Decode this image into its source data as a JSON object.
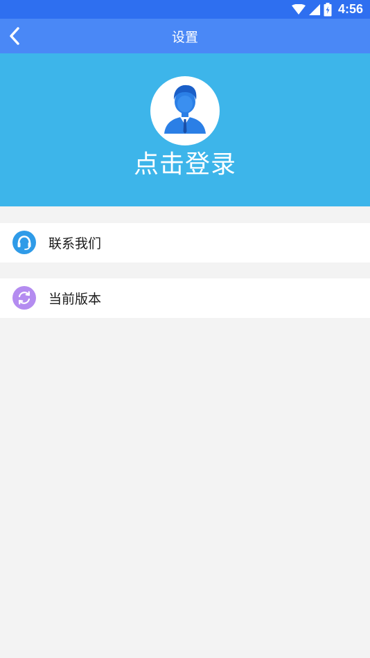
{
  "status_bar": {
    "time": "4:56",
    "icons": [
      "wifi-icon",
      "signal-icon",
      "battery-icon"
    ]
  },
  "app_bar": {
    "title": "设置",
    "back_icon": "chevron-left-icon"
  },
  "header": {
    "avatar_icon": "user-avatar-icon",
    "login_label": "点击登录"
  },
  "menu": {
    "items": [
      {
        "label": "联系我们",
        "icon": "headset-icon",
        "icon_color": "#2f9be8"
      },
      {
        "label": "当前版本",
        "icon": "refresh-icon",
        "icon_color": "#b48cf0"
      }
    ]
  },
  "colors": {
    "status_bar": "#2e6ff0",
    "app_bar": "#4a88f6",
    "header": "#3db5ea",
    "background": "#f3f3f3"
  }
}
